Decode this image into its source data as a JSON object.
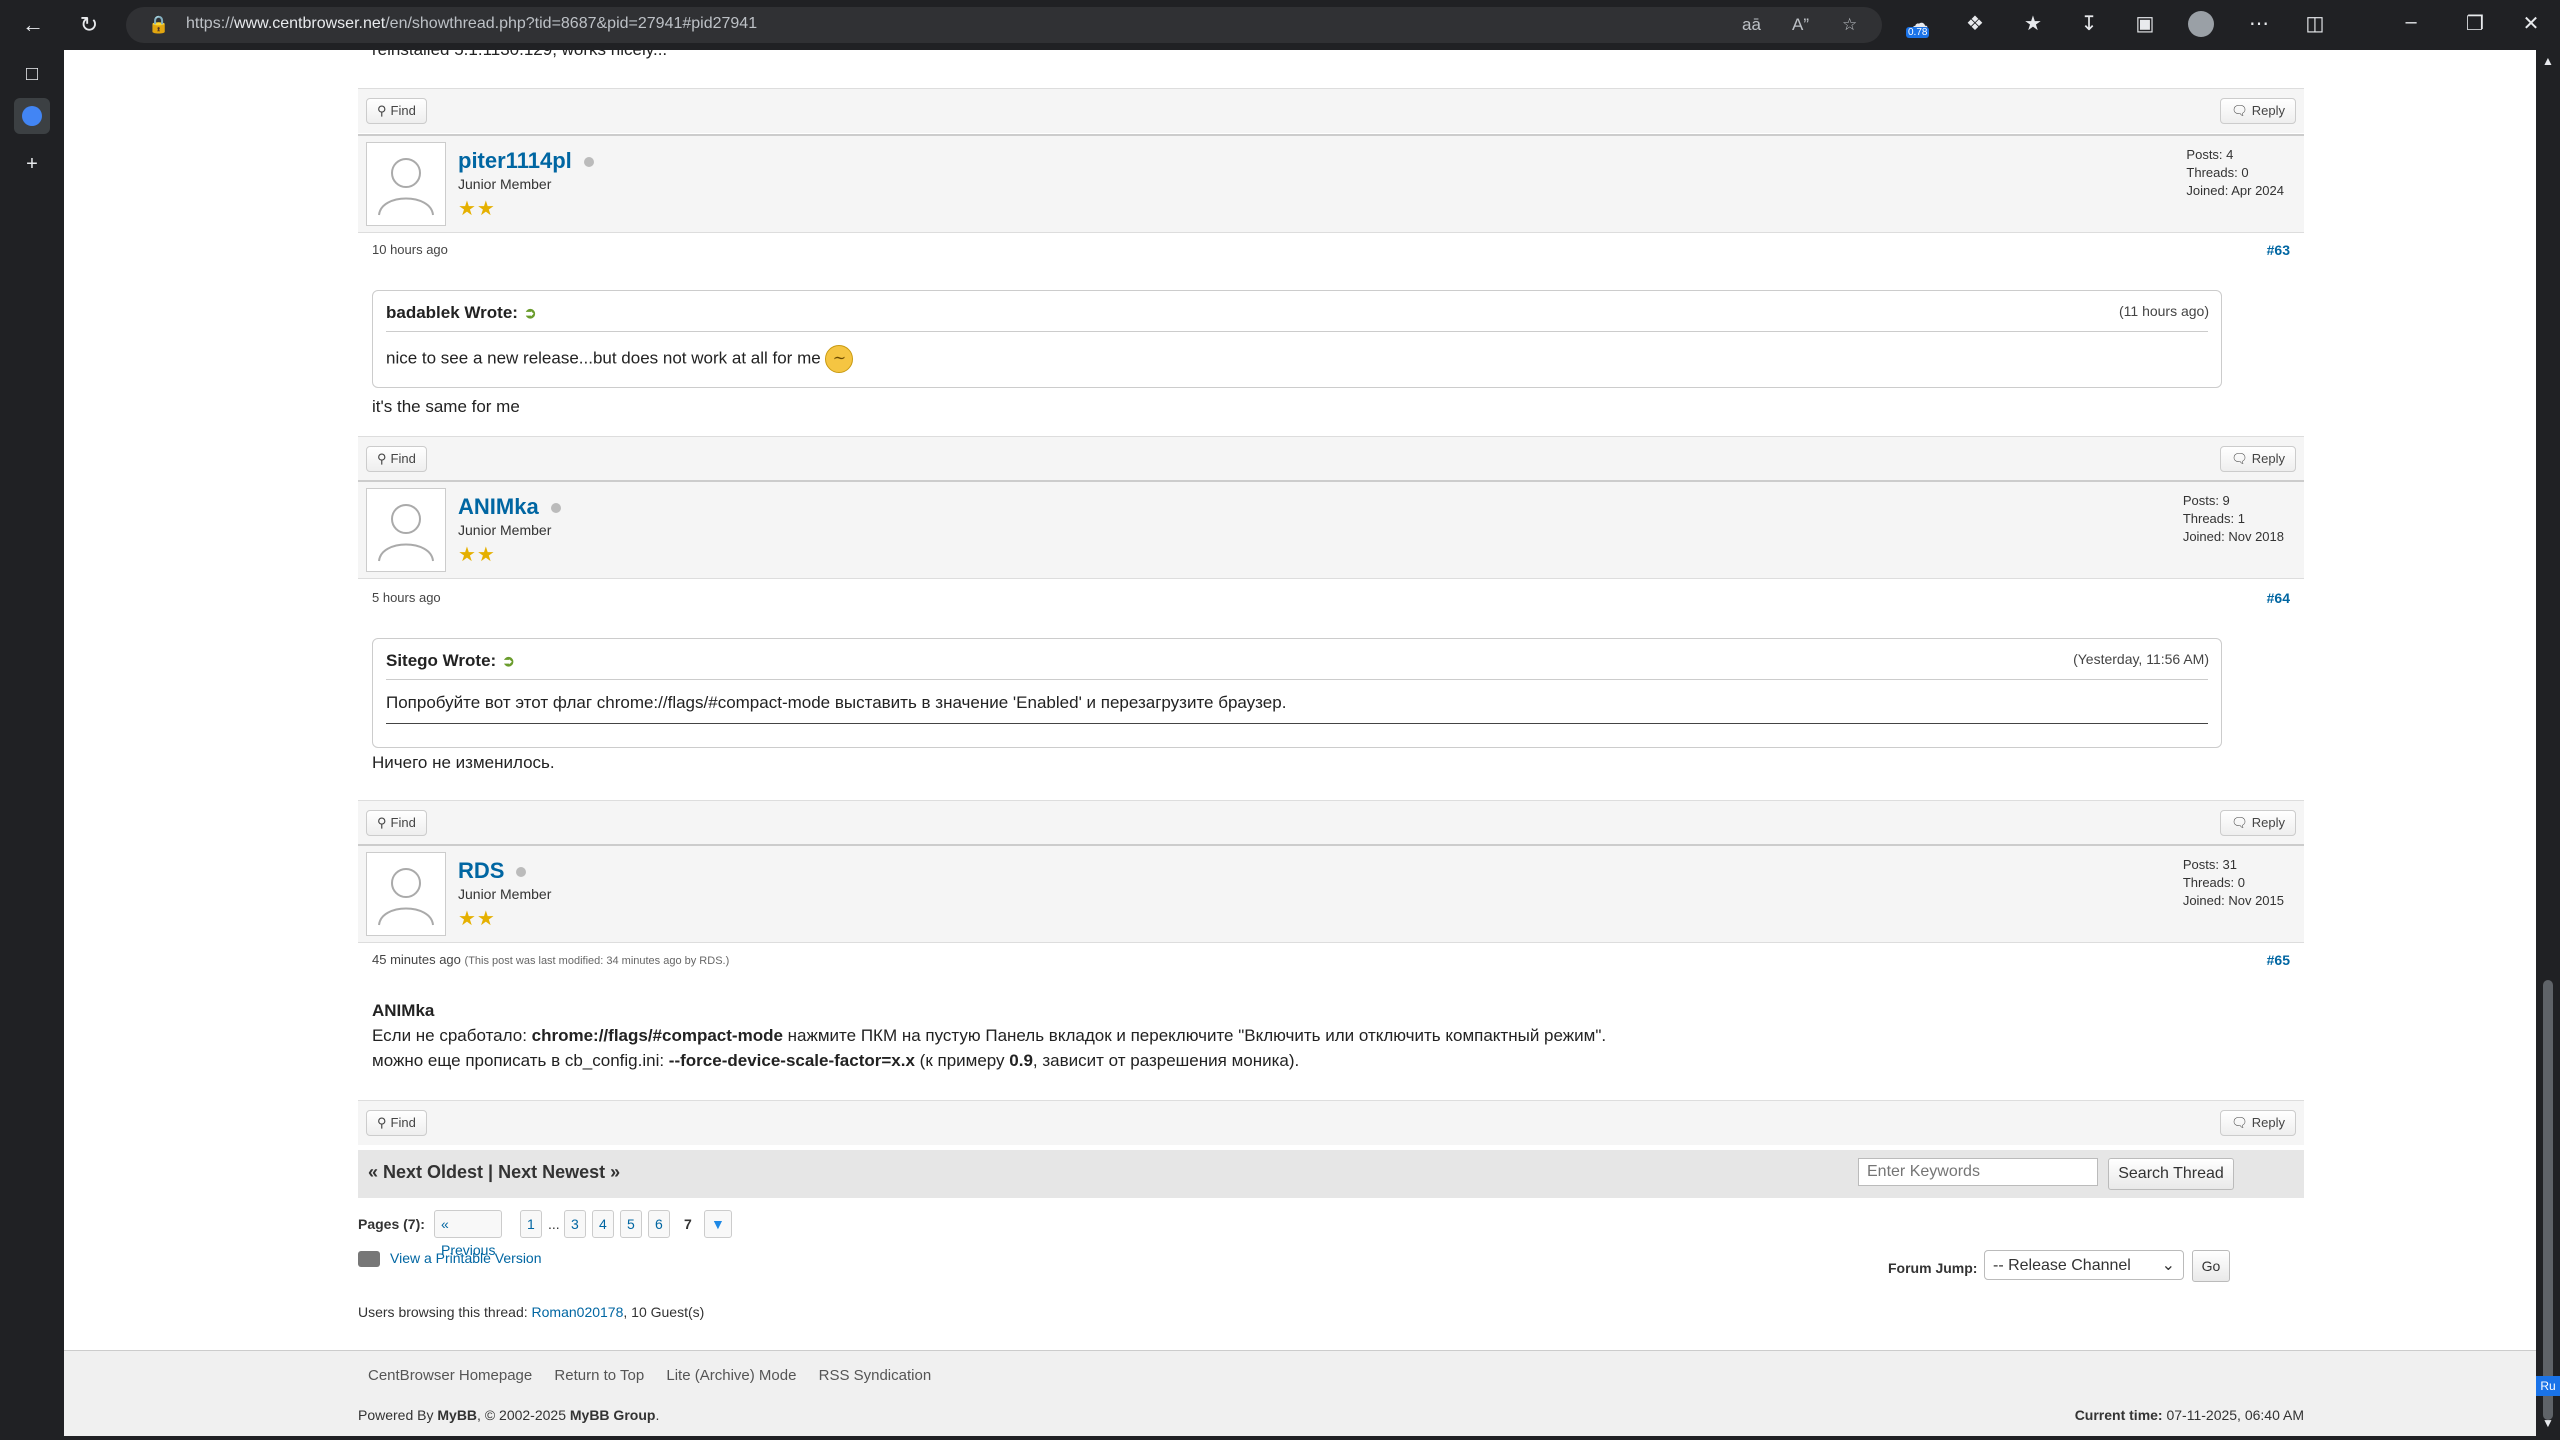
{
  "browser": {
    "url_prefix": "https://",
    "url_domain": "www.centbrowser.net",
    "url_path": "/en/showthread.php?tid=8687&pid=27941#pid27941",
    "extension_badge": "0.78",
    "lang_badge": "Ru"
  },
  "top_fragment": "reinstalled 5.1.1130.129, works nicely...",
  "posts": [
    {
      "author": "piter1114pl",
      "title": "Junior Member",
      "posts": "Posts: 4",
      "threads": "Threads: 0",
      "joined": "Joined: Apr 2024",
      "date": "10 hours ago",
      "number": "#63",
      "quote_author": "badablek Wrote:",
      "quote_time": "(11 hours ago)",
      "quote_body": "nice to see a new release...but does not work at all for me",
      "body": "it's the same for me"
    },
    {
      "author": "ANIMka",
      "title": "Junior Member",
      "posts": "Posts: 9",
      "threads": "Threads: 1",
      "joined": "Joined: Nov 2018",
      "date": "5 hours ago",
      "number": "#64",
      "quote_author": "Sitego Wrote:",
      "quote_time": "(Yesterday, 11:56 AM)",
      "quote_body": "Попробуйте вот этот флаг chrome://flags/#compact-mode выставить в значение 'Enabled' и перезагрузите браузер.",
      "body": "Ничего не изменилось."
    },
    {
      "author": "RDS",
      "title": "Junior Member",
      "posts": "Posts: 31",
      "threads": "Threads: 0",
      "joined": "Joined: Nov 2015",
      "date": "45 minutes ago",
      "modified": "(This post was last modified: 34 minutes ago by RDS.)",
      "number": "#65",
      "body_line1": "ANIMka",
      "body_line2_a": "Если не сработало: ",
      "body_line2_b": "chrome://flags/#compact-mode",
      "body_line2_c": " нажмите ПКМ на пустую Панель вкладок и переключите \"Включить или отключить компактный режим\".",
      "body_line3_a": "можно еще прописать в cb_config.ini: ",
      "body_line3_b": "--force-device-scale-factor=x.x",
      "body_line3_c": " (к примеру ",
      "body_line3_d": "0.9",
      "body_line3_e": ", зависит от разрешения моника)."
    }
  ],
  "buttons": {
    "find": "Find",
    "reply": "Reply"
  },
  "thread_nav": {
    "text": "« Next Oldest | Next Newest »",
    "search_placeholder": "Enter Keywords",
    "search_button": "Search Thread"
  },
  "pagination": {
    "label": "Pages (7):",
    "prev": "« Previous",
    "p1": "1",
    "ellipsis": "...",
    "p3": "3",
    "p4": "4",
    "p5": "5",
    "p6": "6",
    "current": "7"
  },
  "printable": "View a Printable Version",
  "forum_jump": {
    "label": "Forum Jump:",
    "selected": "-- Release Channel",
    "go": "Go"
  },
  "browsing": {
    "prefix": "Users browsing this thread: ",
    "user": "Roman020178",
    "suffix": ", 10 Guest(s)"
  },
  "footer": {
    "links": [
      "CentBrowser Homepage",
      "Return to Top",
      "Lite (Archive) Mode",
      "RSS Syndication"
    ],
    "powered_a": "Powered By ",
    "powered_b": "MyBB",
    "powered_c": ", © 2002-2025 ",
    "powered_d": "MyBB Group",
    "powered_e": ".",
    "time_label": "Current time:",
    "time_value": "07-11-2025, 06:40 AM"
  }
}
